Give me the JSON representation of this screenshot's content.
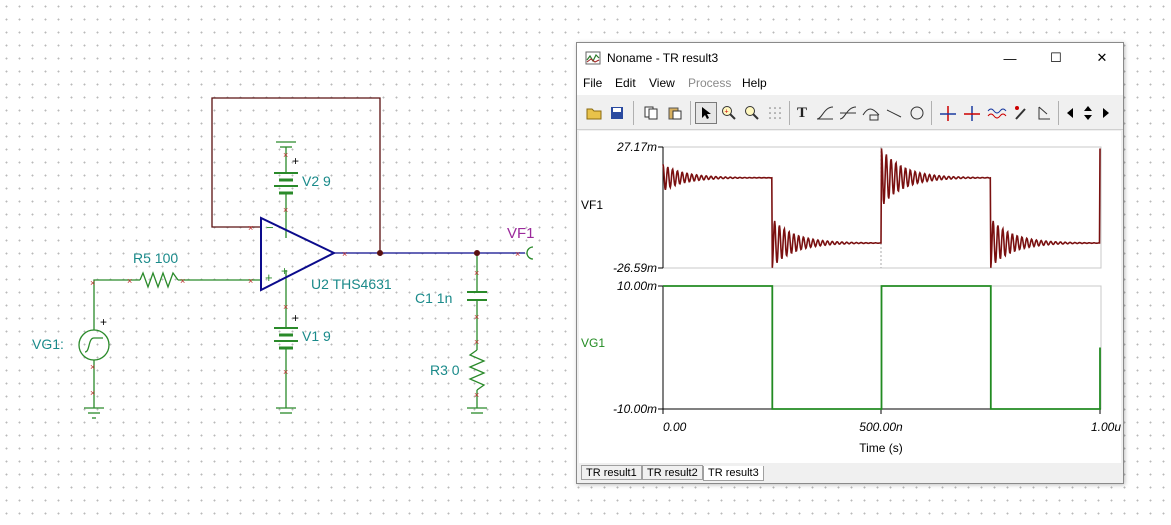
{
  "schematic": {
    "components": {
      "r5": "R5 100",
      "vg1": "VG1:",
      "v2": "V2 9",
      "v1": "V1 9",
      "u2": "U2 THS4631",
      "vf1": "VF1",
      "c1": "C1 1n",
      "r3": "R3 0"
    },
    "plus": "+",
    "minus": "−"
  },
  "window": {
    "title": "Noname - TR result3",
    "icon": "chart-app-icon",
    "menu": [
      "File",
      "Edit",
      "View",
      "Process",
      "Help"
    ],
    "menu_disabled": [
      "Process"
    ],
    "tabs": [
      "TR result1",
      "TR result2",
      "TR result3"
    ],
    "active_tab": "TR result3",
    "toolbar_icons": [
      "open-icon",
      "save-icon",
      "copy-icon",
      "paste-icon",
      "pointer-icon",
      "zoom-in-icon",
      "zoom-100-icon",
      "grid-icon",
      "text-icon",
      "curve-a-icon",
      "curve-b-icon",
      "curve-c-icon",
      "line-icon",
      "circle-icon",
      "cursor-a-icon",
      "cursor-b-icon",
      "wave-icon",
      "probe-icon",
      "angle-icon",
      "scroll-left-icon",
      "scroll-updown-icon",
      "scroll-right-icon"
    ]
  },
  "chart_data": [
    {
      "type": "line",
      "ylabel": "VF1",
      "ylim": [
        -0.02659,
        0.02717
      ],
      "ytick_labels": [
        "27.17m",
        "-26.59m"
      ],
      "color": "#7a1010",
      "x": [
        0,
        2.5e-07,
        2.5e-07,
        5e-07,
        5e-07,
        7.5e-07,
        7.5e-07,
        1e-06
      ],
      "y": [
        0.0135,
        0.0135,
        -0.0265,
        -0.0155,
        0.027,
        0.0135,
        -0.0265,
        -0.0155
      ],
      "note_visible": "damped ringing after each edge"
    },
    {
      "type": "line",
      "ylabel": "VG1",
      "ylim": [
        -10,
        10
      ],
      "ytick_labels": [
        "10.00m",
        "-10.00m"
      ],
      "color": "#228b22",
      "x": [
        0,
        2.5e-07,
        2.5e-07,
        5e-07,
        5e-07,
        7.5e-07,
        7.5e-07,
        1e-06,
        1e-06
      ],
      "y": [
        10,
        10,
        -10,
        -10,
        10,
        10,
        -10,
        -10,
        0
      ],
      "xlabel": "Time (s)",
      "xtick_labels": [
        "0.00",
        "500.00n",
        "1.00u"
      ],
      "xlim": [
        0,
        1e-06
      ]
    }
  ]
}
